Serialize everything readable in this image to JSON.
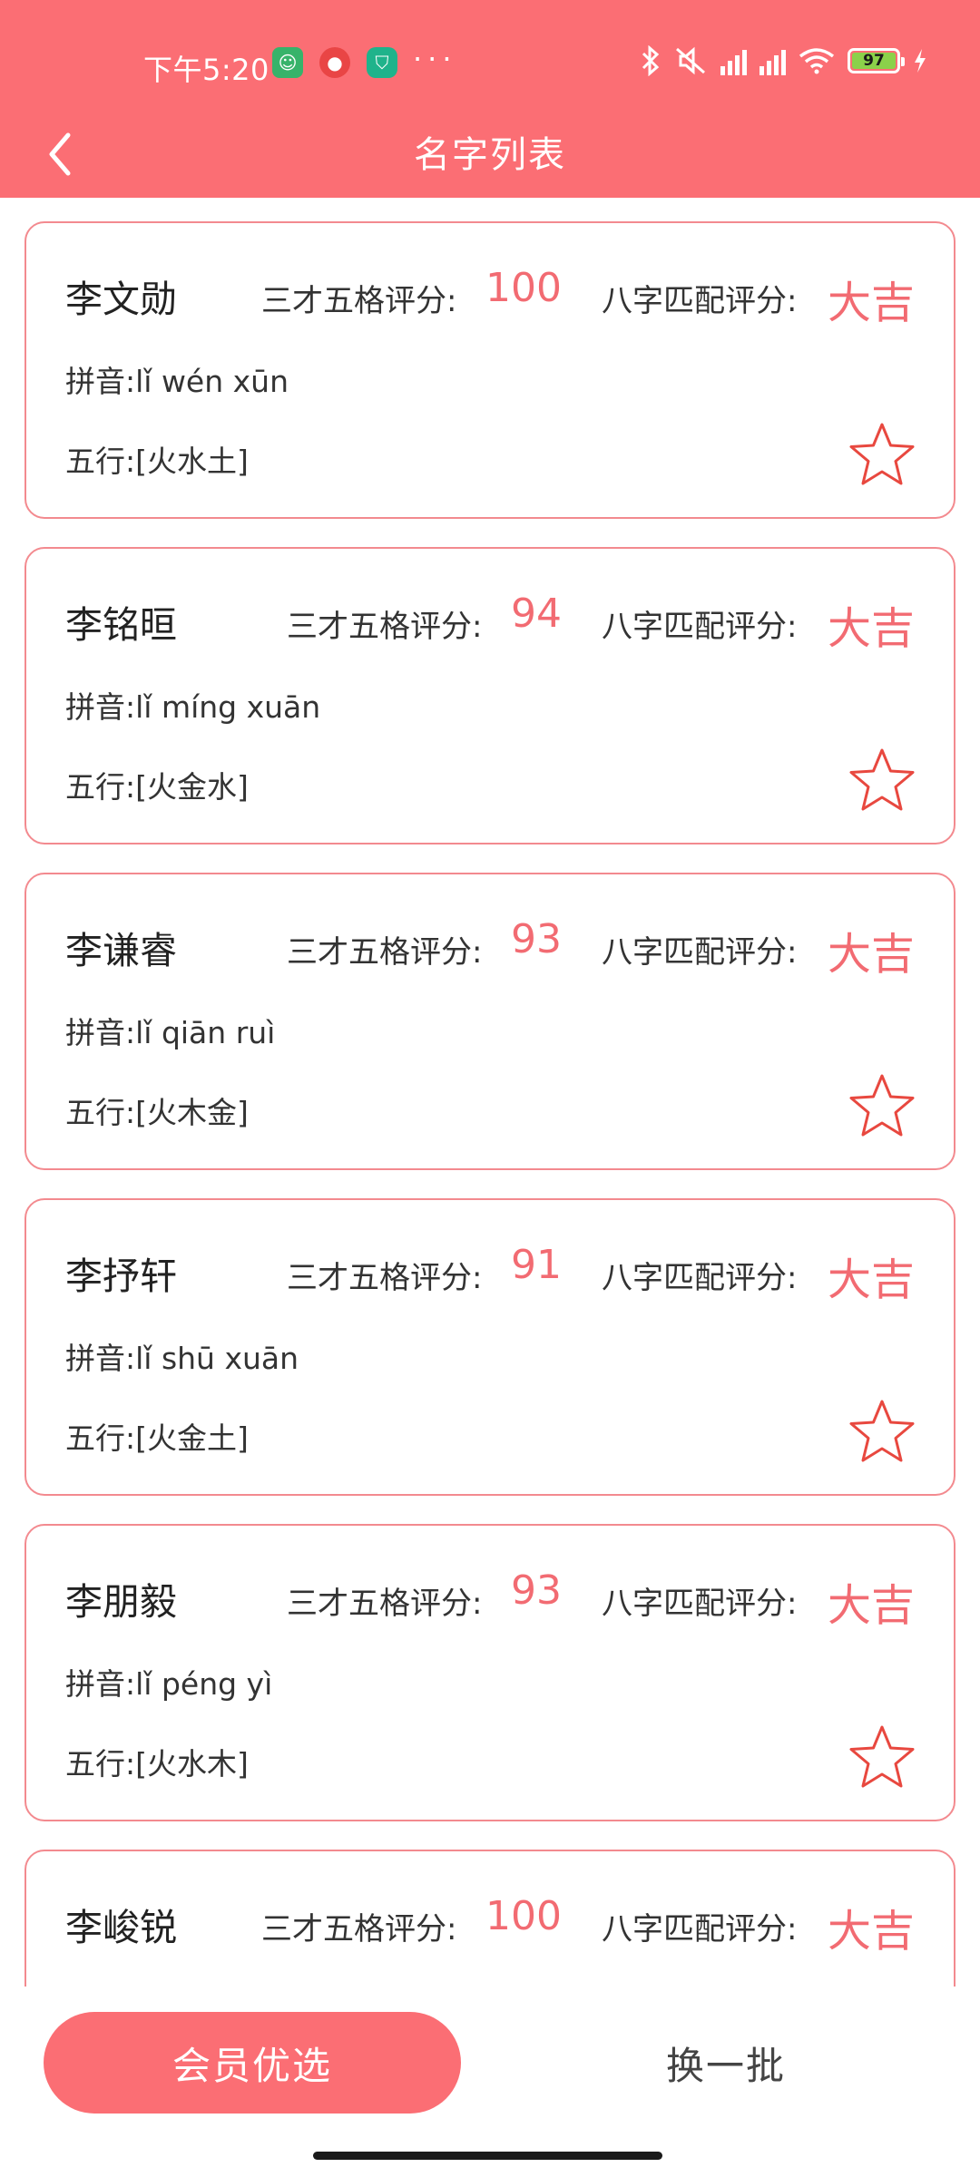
{
  "status_bar": {
    "time": "下午5:20",
    "dots": "···",
    "battery": "97"
  },
  "header": {
    "title": "名字列表"
  },
  "labels": {
    "sancai": "三才五格评分:",
    "bazi": "八字匹配评分:"
  },
  "names": [
    {
      "name": "李文勋",
      "score": "100",
      "bazi": "大吉",
      "pinyin": "拼音:lǐ wén xūn",
      "wuxing": "五行:[火水土]"
    },
    {
      "name": "李铭晅",
      "score": "94",
      "bazi": "大吉",
      "pinyin": "拼音:lǐ míng xuān",
      "wuxing": "五行:[火金水]"
    },
    {
      "name": "李谦睿",
      "score": "93",
      "bazi": "大吉",
      "pinyin": "拼音:lǐ qiān ruì",
      "wuxing": "五行:[火木金]"
    },
    {
      "name": "李抒轩",
      "score": "91",
      "bazi": "大吉",
      "pinyin": "拼音:lǐ shū xuān",
      "wuxing": "五行:[火金土]"
    },
    {
      "name": "李朋毅",
      "score": "93",
      "bazi": "大吉",
      "pinyin": "拼音:lǐ péng yì",
      "wuxing": "五行:[火水木]"
    },
    {
      "name": "李峻锐",
      "score": "100",
      "bazi": "大吉",
      "pinyin": "",
      "wuxing": ""
    }
  ],
  "bottom": {
    "vip_label": "会员优选",
    "refresh_label": "换一批"
  },
  "colors": {
    "accent": "#fb6e74",
    "score_text": "#f26b72",
    "card_border": "#f38a8f",
    "star_stroke": "#e8483f"
  }
}
